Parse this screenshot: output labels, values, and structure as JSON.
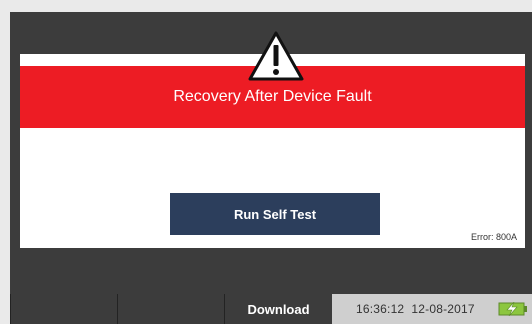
{
  "dialog": {
    "title": "Recovery After Device Fault",
    "action_button": "Run Self Test",
    "error_code": "Error: 800A"
  },
  "taskbar": {
    "buttons": [
      "",
      "",
      "Download"
    ],
    "time": "16:36:12",
    "date": "12-08-2017"
  },
  "icons": {
    "warning": "warning-triangle-icon",
    "battery": "battery-charging-icon"
  },
  "colors": {
    "header_red": "#ed1c24",
    "button_navy": "#2c3e5c",
    "battery_green": "#8cc63f",
    "screen_background": "#3c3c3c"
  }
}
